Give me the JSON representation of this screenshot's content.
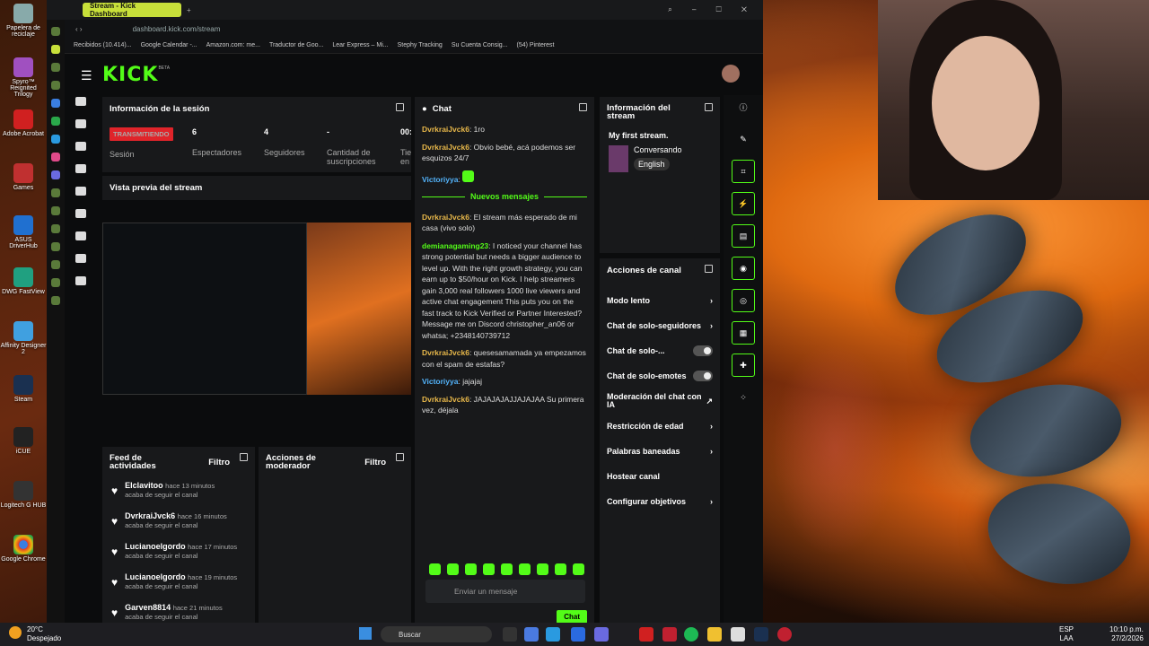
{
  "browser": {
    "tab_title": "Stream - Kick Dashboard",
    "url": "dashboard.kick.com/stream",
    "bookmarks": [
      "Recibidos (10.414)...",
      "Google Calendar -...",
      "Amazon.com: me...",
      "Traductor de Goo...",
      "Lear Express – Mi...",
      "Stephy Tracking",
      "Su Cuenta Consig...",
      "(54) Pinterest"
    ]
  },
  "desktop": [
    "Papelera de reciclaje",
    "Spyro™ Reignited Trilogy",
    "Adobe Acrobat",
    "Games",
    "ASUS DriverHub",
    "DWG FastView",
    "Affinity Designer 2",
    "Steam",
    "iCUE",
    "Logitech G HUB",
    "Google Chrome"
  ],
  "kick": {
    "logo": "KICK",
    "logo_beta": "BETA",
    "session": {
      "title": "Información de la sesión",
      "status": "TRANSMITIENDO",
      "status_label": "Sesión",
      "viewers": "6",
      "viewers_label": "Espectadores",
      "followers": "4",
      "followers_label": "Seguidores",
      "subs": "-",
      "subs_label": "Cantidad de suscripciones",
      "time": "00:",
      "time_label": "Tie en"
    },
    "preview": {
      "title": "Vista previa del stream"
    },
    "feed": {
      "title": "Feed de actividades",
      "filter": "Filtro",
      "items": [
        {
          "user": "Elclavitoo",
          "time": "hace 13 minutos",
          "action": "acaba de seguir el canal"
        },
        {
          "user": "DvrkraiJvck6",
          "time": "hace 16 minutos",
          "action": "acaba de seguir el canal"
        },
        {
          "user": "Lucianoelgordo",
          "time": "hace 17 minutos",
          "action": "acaba de seguir el canal"
        },
        {
          "user": "Lucianoelgordo",
          "time": "hace 19 minutos",
          "action": "acaba de seguir el canal"
        },
        {
          "user": "Garven8814",
          "time": "hace 21 minutos",
          "action": "acaba de seguir el canal"
        }
      ]
    },
    "mod": {
      "title": "Acciones de moderador",
      "filter": "Filtro"
    },
    "chat": {
      "title": "Chat",
      "new_messages": "Nuevos mensajes",
      "placeholder": "Enviar un mensaje",
      "send": "Chat",
      "messages": [
        {
          "user": "DvrkraiJvck6",
          "text": "1ro",
          "color": "#e8b84a"
        },
        {
          "user": "DvrkraiJvck6",
          "text": "Obvio bebé, acá podemos ser esquizos 24/7",
          "color": "#e8b84a"
        },
        {
          "user": "Victoriyya",
          "text": "",
          "color": "#53b4fc"
        },
        {
          "user": "DvrkraiJvck6",
          "text": "El stream más esperado de mi casa (vivo solo)",
          "color": "#e8b84a"
        },
        {
          "user": "demianagaming23",
          "text": "I noticed your channel has strong potential but needs a bigger audience to level up. With the right growth strategy, you can earn up to $50/hour on Kick. I help streamers gain 3,000 real followers 1000 live viewers and active chat engagement This puts you on the fast track to Kick Verified or Partner Interested? Message me on Discord christopher_an06 or whatsa; +2348140739712",
          "color": "#53fc18"
        },
        {
          "user": "DvrkraiJvck6",
          "text": "quesesamamada ya empezamos con el spam de estafas?",
          "color": "#e8b84a"
        },
        {
          "user": "Victoriyya",
          "text": "jajajaj",
          "color": "#53b4fc"
        },
        {
          "user": "DvrkraiJvck6",
          "text": "JAJAJAJAJJAJAJAA Su primera vez, déjala",
          "color": "#e8b84a"
        }
      ]
    },
    "info": {
      "title": "Información del stream",
      "stream_title": "My first stream.",
      "category": "Conversando",
      "language": "English"
    },
    "actions": {
      "title": "Acciones de canal",
      "items": [
        "Modo lento",
        "Chat de solo-seguidores",
        "Chat de solo-...",
        "Chat de solo-emotes",
        "Moderación del chat con IA",
        "Restricción de edad",
        "Palabras baneadas",
        "Hostear canal",
        "Configurar objetivos"
      ]
    }
  },
  "taskbar": {
    "weather": "20°C",
    "weather_desc": "Despejado",
    "search": "Buscar",
    "lang": "ESP",
    "lang2": "LAA",
    "time": "10:10 p.m.",
    "date": "27/2/2026"
  }
}
